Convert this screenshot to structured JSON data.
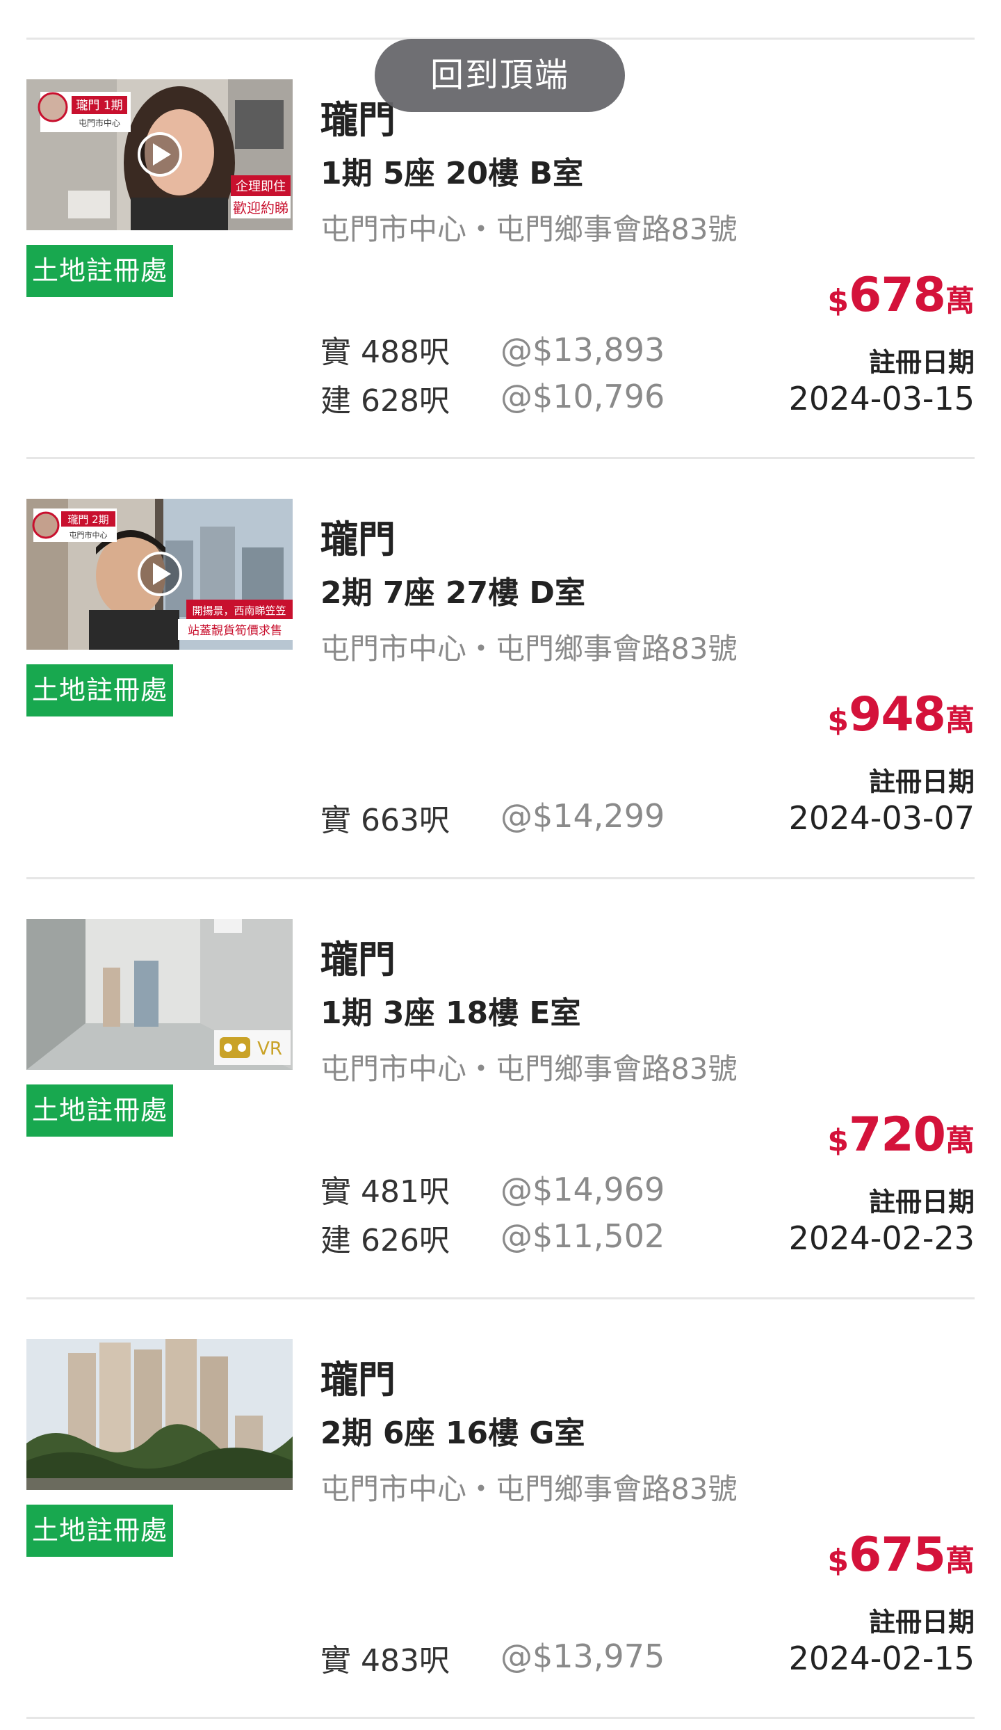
{
  "back_to_top": "回到頂端",
  "listings": [
    {
      "estate": "瓏門",
      "unit": "1期 5座 20樓 B室",
      "address": "屯門市中心・屯門鄉事會路83號",
      "badge": "土地註冊處",
      "currency": "$",
      "price": "678",
      "price_unit": "萬",
      "regdate_label": "註冊日期",
      "regdate": "2024-03-15",
      "areas": [
        {
          "label": "實 488呎",
          "ppsf": "@$13,893"
        },
        {
          "label": "建 628呎",
          "ppsf": "@$10,796"
        }
      ],
      "thumb": {
        "kind": "video",
        "tag_title": "瓏門 1期",
        "tag_sub": "屯門市中心",
        "caption": [
          "企理即住",
          "歡迎約睇"
        ]
      }
    },
    {
      "estate": "瓏門",
      "unit": "2期 7座 27樓 D室",
      "address": "屯門市中心・屯門鄉事會路83號",
      "badge": "土地註冊處",
      "currency": "$",
      "price": "948",
      "price_unit": "萬",
      "regdate_label": "註冊日期",
      "regdate": "2024-03-07",
      "areas": [
        {
          "label": "實 663呎",
          "ppsf": "@$14,299"
        }
      ],
      "thumb": {
        "kind": "video",
        "tag_title": "瓏門 2期",
        "tag_sub": "屯門市中心",
        "caption": [
          "開揚景，西南睇笠笠",
          "站蓋靚貨筍價求售"
        ]
      }
    },
    {
      "estate": "瓏門",
      "unit": "1期 3座 18樓 E室",
      "address": "屯門市中心・屯門鄉事會路83號",
      "badge": "土地註冊處",
      "currency": "$",
      "price": "720",
      "price_unit": "萬",
      "regdate_label": "註冊日期",
      "regdate": "2024-02-23",
      "areas": [
        {
          "label": "實 481呎",
          "ppsf": "@$14,969"
        },
        {
          "label": "建 626呎",
          "ppsf": "@$11,502"
        }
      ],
      "thumb": {
        "kind": "vr",
        "vr_label": "VR"
      }
    },
    {
      "estate": "瓏門",
      "unit": "2期 6座 16樓 G室",
      "address": "屯門市中心・屯門鄉事會路83號",
      "badge": "土地註冊處",
      "currency": "$",
      "price": "675",
      "price_unit": "萬",
      "regdate_label": "註冊日期",
      "regdate": "2024-02-15",
      "areas": [
        {
          "label": "實 483呎",
          "ppsf": "@$13,975"
        }
      ],
      "thumb": {
        "kind": "photo"
      }
    }
  ]
}
